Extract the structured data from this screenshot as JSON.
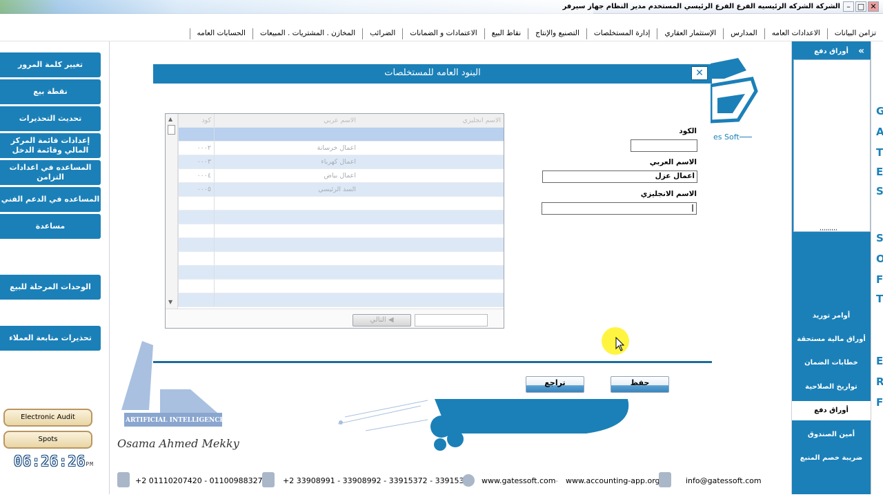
{
  "window": {
    "title": "الشركة الشركه الرئيسيه  الفرع الفرع الرئيسي  المستخدم مدير النظام  جهاز سيرفر"
  },
  "menu": [
    "الحسابات العامه",
    "المخازن . المشتريات . المبيعات",
    "الضرائب",
    "الاعتمادات و الضمانات",
    "نقاط البيع",
    "التصنيع والإنتاج",
    "إدارة المستخلصات",
    "الإستثمار العقاري",
    "المدارس",
    "الاعدادات العامه",
    "تزامن البيانات"
  ],
  "left_buttons": [
    "تغيير كلمة المرور",
    "نقطة بيع",
    "تحديث التحذيرات",
    "إعدادات قائمة المركز المالي وقائمة الدخل",
    "المساعده في اعدادات التزامن",
    "المساعده في الدعم الفني",
    "مساعدة",
    "الوحدات المرحلة للبيع",
    "تحذيرات متابعة العملاء"
  ],
  "pills": {
    "audit": "Electronic Audit",
    "spots": "Spots"
  },
  "clock": {
    "time": "06:26:26",
    "ampm": "PM"
  },
  "dialog": {
    "title": "البنود العامه للمستخلصات",
    "close": "✕",
    "code_label": "الكود",
    "code_value": "",
    "arabic_label": "الاسم العربي",
    "arabic_value": "اعمال عزل",
    "english_label": "الاسم الانجليزي",
    "english_value": "|",
    "grid_headers": [
      "كود",
      "الاسم عربي",
      "الاسم انجليزي"
    ],
    "grid_rows": [
      [
        "",
        "",
        ""
      ],
      [
        "٠٠٠٢",
        "اعمال خرسانة",
        ""
      ],
      [
        "٠٠٠٣",
        "اعمال كهرباء",
        ""
      ],
      [
        "٠٠٠٤",
        "اعمال بياض",
        ""
      ],
      [
        "٠٠٠٥",
        "السد الرئيسي",
        ""
      ]
    ],
    "next_label": "التالي",
    "save_label": "حفظ",
    "back_label": "تراجع"
  },
  "branding": {
    "ai_label": "ARTIFICIAL INTELLIGENCE",
    "signature": "Osama Ahmed Mekky",
    "logo_text": "es Soft"
  },
  "footer": {
    "mobile": "+2 01110207420 - 01100988327",
    "phones": "+2 33908991 - 33908992 - 33915372 - 33915373",
    "web1": "www.gatessoft.com",
    "web2": "www.accounting-app.org",
    "email": "info@gatessoft.com"
  },
  "right_panel": {
    "header": "أوراق دفع",
    "collapse": "«",
    "dots": ",,,,,,,,,",
    "items": [
      "أوامر توريد",
      "أوراق مالية مستحقة",
      "خطابات الضمان",
      "تواريخ الصلاحية",
      "أوراق دفع",
      "أمين الصندوق",
      "ضريبة خصم المنبع"
    ],
    "letters": [
      "G",
      "A",
      "T",
      "E",
      "S",
      "S",
      "O",
      "F",
      "T",
      "E",
      "R",
      "F"
    ]
  },
  "colors": {
    "accent": "#1b80b8",
    "highlight": "#fff200"
  }
}
